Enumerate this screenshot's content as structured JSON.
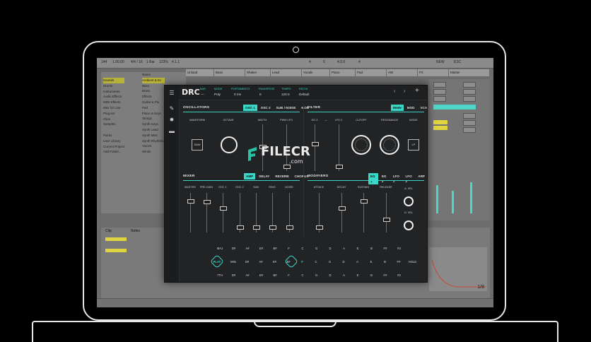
{
  "daw": {
    "top_bar": [
      "144",
      "1.00.00",
      "4/4 / 16",
      "1 Bar",
      "123%",
      "4.1.1",
      "4",
      "0",
      "4.0.0",
      "4",
      "NEW",
      "ESC"
    ],
    "browser_places": [
      "Sounds",
      "Drums",
      "Instruments",
      "Audio Effects",
      "MIDI Effects",
      "Max for Live",
      "Plug-ins",
      "Clips",
      "Samples",
      "",
      "Packs",
      "User Library",
      "Current Project",
      "Add Folder..."
    ],
    "browser_categories": [
      "Name",
      "Ambient & Ev",
      "Bass",
      "Brass",
      "Effects",
      "Guitar & Plu",
      "Pad",
      "Piano & Keys",
      "Strings",
      "Synth Keys",
      "Synth Lead",
      "Synth Misc",
      "Synth Rhythmic",
      "Voices",
      "Winds"
    ],
    "tracks": [
      "Unload",
      "Bass",
      "Shaker",
      "Lead",
      "Vocals",
      "Piano",
      "Pad",
      "AW",
      "FX",
      "Master"
    ],
    "clip_label": "Clip",
    "notes_label": "Notes",
    "position": "1/8"
  },
  "plugin": {
    "logo": "DRC",
    "header_params": [
      {
        "label": "BAR",
        "value": "—"
      },
      {
        "label": "MODE",
        "value": "Poly"
      },
      {
        "label": "PORTAMENTO",
        "value": "0 ms"
      },
      {
        "label": "TRANSPOSE",
        "value": "0"
      },
      {
        "label": "TEMPO",
        "value": "120.0"
      },
      {
        "label": "PATCH",
        "value": "Default"
      }
    ],
    "nav": {
      "prev": "‹",
      "next": "›",
      "add": "+"
    },
    "oscillators": {
      "title": "OSCILLATORS",
      "tabs": [
        "OSC 1",
        "OSC 2",
        "SUB / NOISE",
        "MOD"
      ],
      "active_tab": 0,
      "labels": [
        "WAVEFORM",
        "OCTAVE",
        "WIDTH",
        "PWM LFO"
      ],
      "waveform_button": "SAW"
    },
    "filter": {
      "title": "FILTER",
      "tabs": [
        "MAIN",
        "MOD",
        "VCA"
      ],
      "active_tab": 0,
      "labels": [
        "EG 2",
        "LFO 2",
        "CUTOFF",
        "RESONANCE",
        "MODE"
      ],
      "lfo_sep": "—",
      "mode_button": "LP"
    },
    "mixer": {
      "title": "MIXER",
      "tabs": [
        "AMP",
        "DELAY",
        "REVERB",
        "CHORUS"
      ],
      "active_tab": 0,
      "labels": [
        "MASTER",
        "PRE-GAIN",
        "OSC 1",
        "OSC 2",
        "SUB",
        "RING",
        "NOISE"
      ],
      "levels": [
        0.82,
        0.8,
        0.62,
        0.08,
        0.08,
        0.08,
        0.08
      ]
    },
    "modifiers": {
      "title": "MODIFIERS",
      "tabs": [
        "EG 1",
        "EG 2",
        "LFO 1",
        "LFO 2",
        "ARP"
      ],
      "active_tab": 0,
      "labels": [
        "ATTACK",
        "DECAY",
        "SUSTAIN",
        "RELEASE",
        "A. VEL",
        "D. VEL"
      ],
      "levels": [
        0.08,
        0.62,
        0.82,
        0.3
      ]
    },
    "keys": {
      "row1": [
        "MAJ",
        "D#",
        "A#",
        "E#",
        "B#",
        "F",
        "C",
        "G",
        "D",
        "A",
        "E",
        "B",
        "F#",
        "#4"
      ],
      "row2_left": "PLAY",
      "row2": [
        "MIN",
        "D#",
        "A#",
        "E#",
        "B#",
        "F",
        "C",
        "G",
        "D",
        "A",
        "E",
        "B",
        "F#",
        "HOLD"
      ],
      "row2_highlight": "F",
      "row3": [
        "7TH",
        "D#",
        "A#",
        "E#",
        "B#",
        "F",
        "C",
        "G",
        "D",
        "A",
        "E",
        "B",
        "F#",
        "#2"
      ]
    }
  },
  "watermark": {
    "text": "FILECR",
    "sub": ".com"
  },
  "colors": {
    "accent": "#3ad7c7",
    "panel": "#222325",
    "highlight": "#b9b23a"
  }
}
